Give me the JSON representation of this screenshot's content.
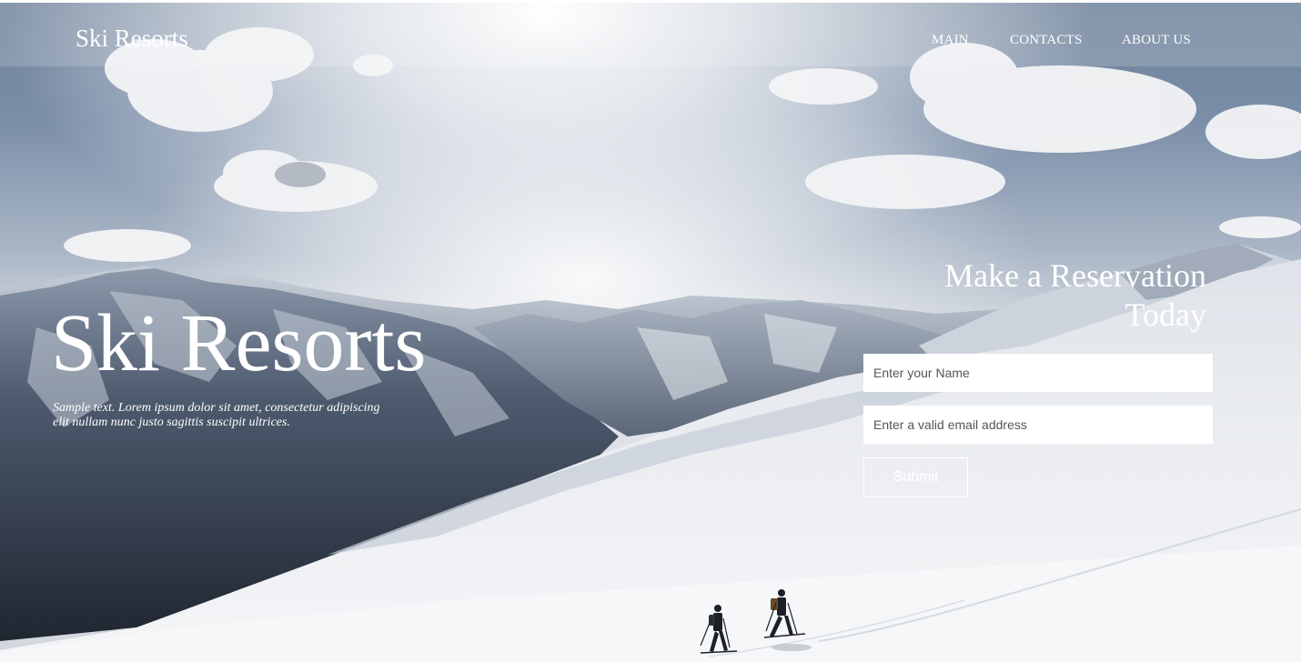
{
  "header": {
    "logo": "Ski Resorts",
    "nav": [
      {
        "label": "MAIN"
      },
      {
        "label": "CONTACTS"
      },
      {
        "label": "ABOUT US"
      }
    ]
  },
  "hero": {
    "title": "Ski Resorts",
    "text": "Sample text. Lorem ipsum dolor sit amet, consectetur adipiscing elit nullam nunc justo sagittis suscipit ultrices."
  },
  "reservation": {
    "title": "Make a Reservation Today",
    "name_placeholder": "Enter your Name",
    "email_placeholder": "Enter a valid email address",
    "submit_label": "Submit"
  },
  "colors": {
    "text": "#ffffff",
    "sky": "#5d7393",
    "snow": "#eef0f3",
    "header_overlay": "rgba(255,255,255,0.16)"
  }
}
